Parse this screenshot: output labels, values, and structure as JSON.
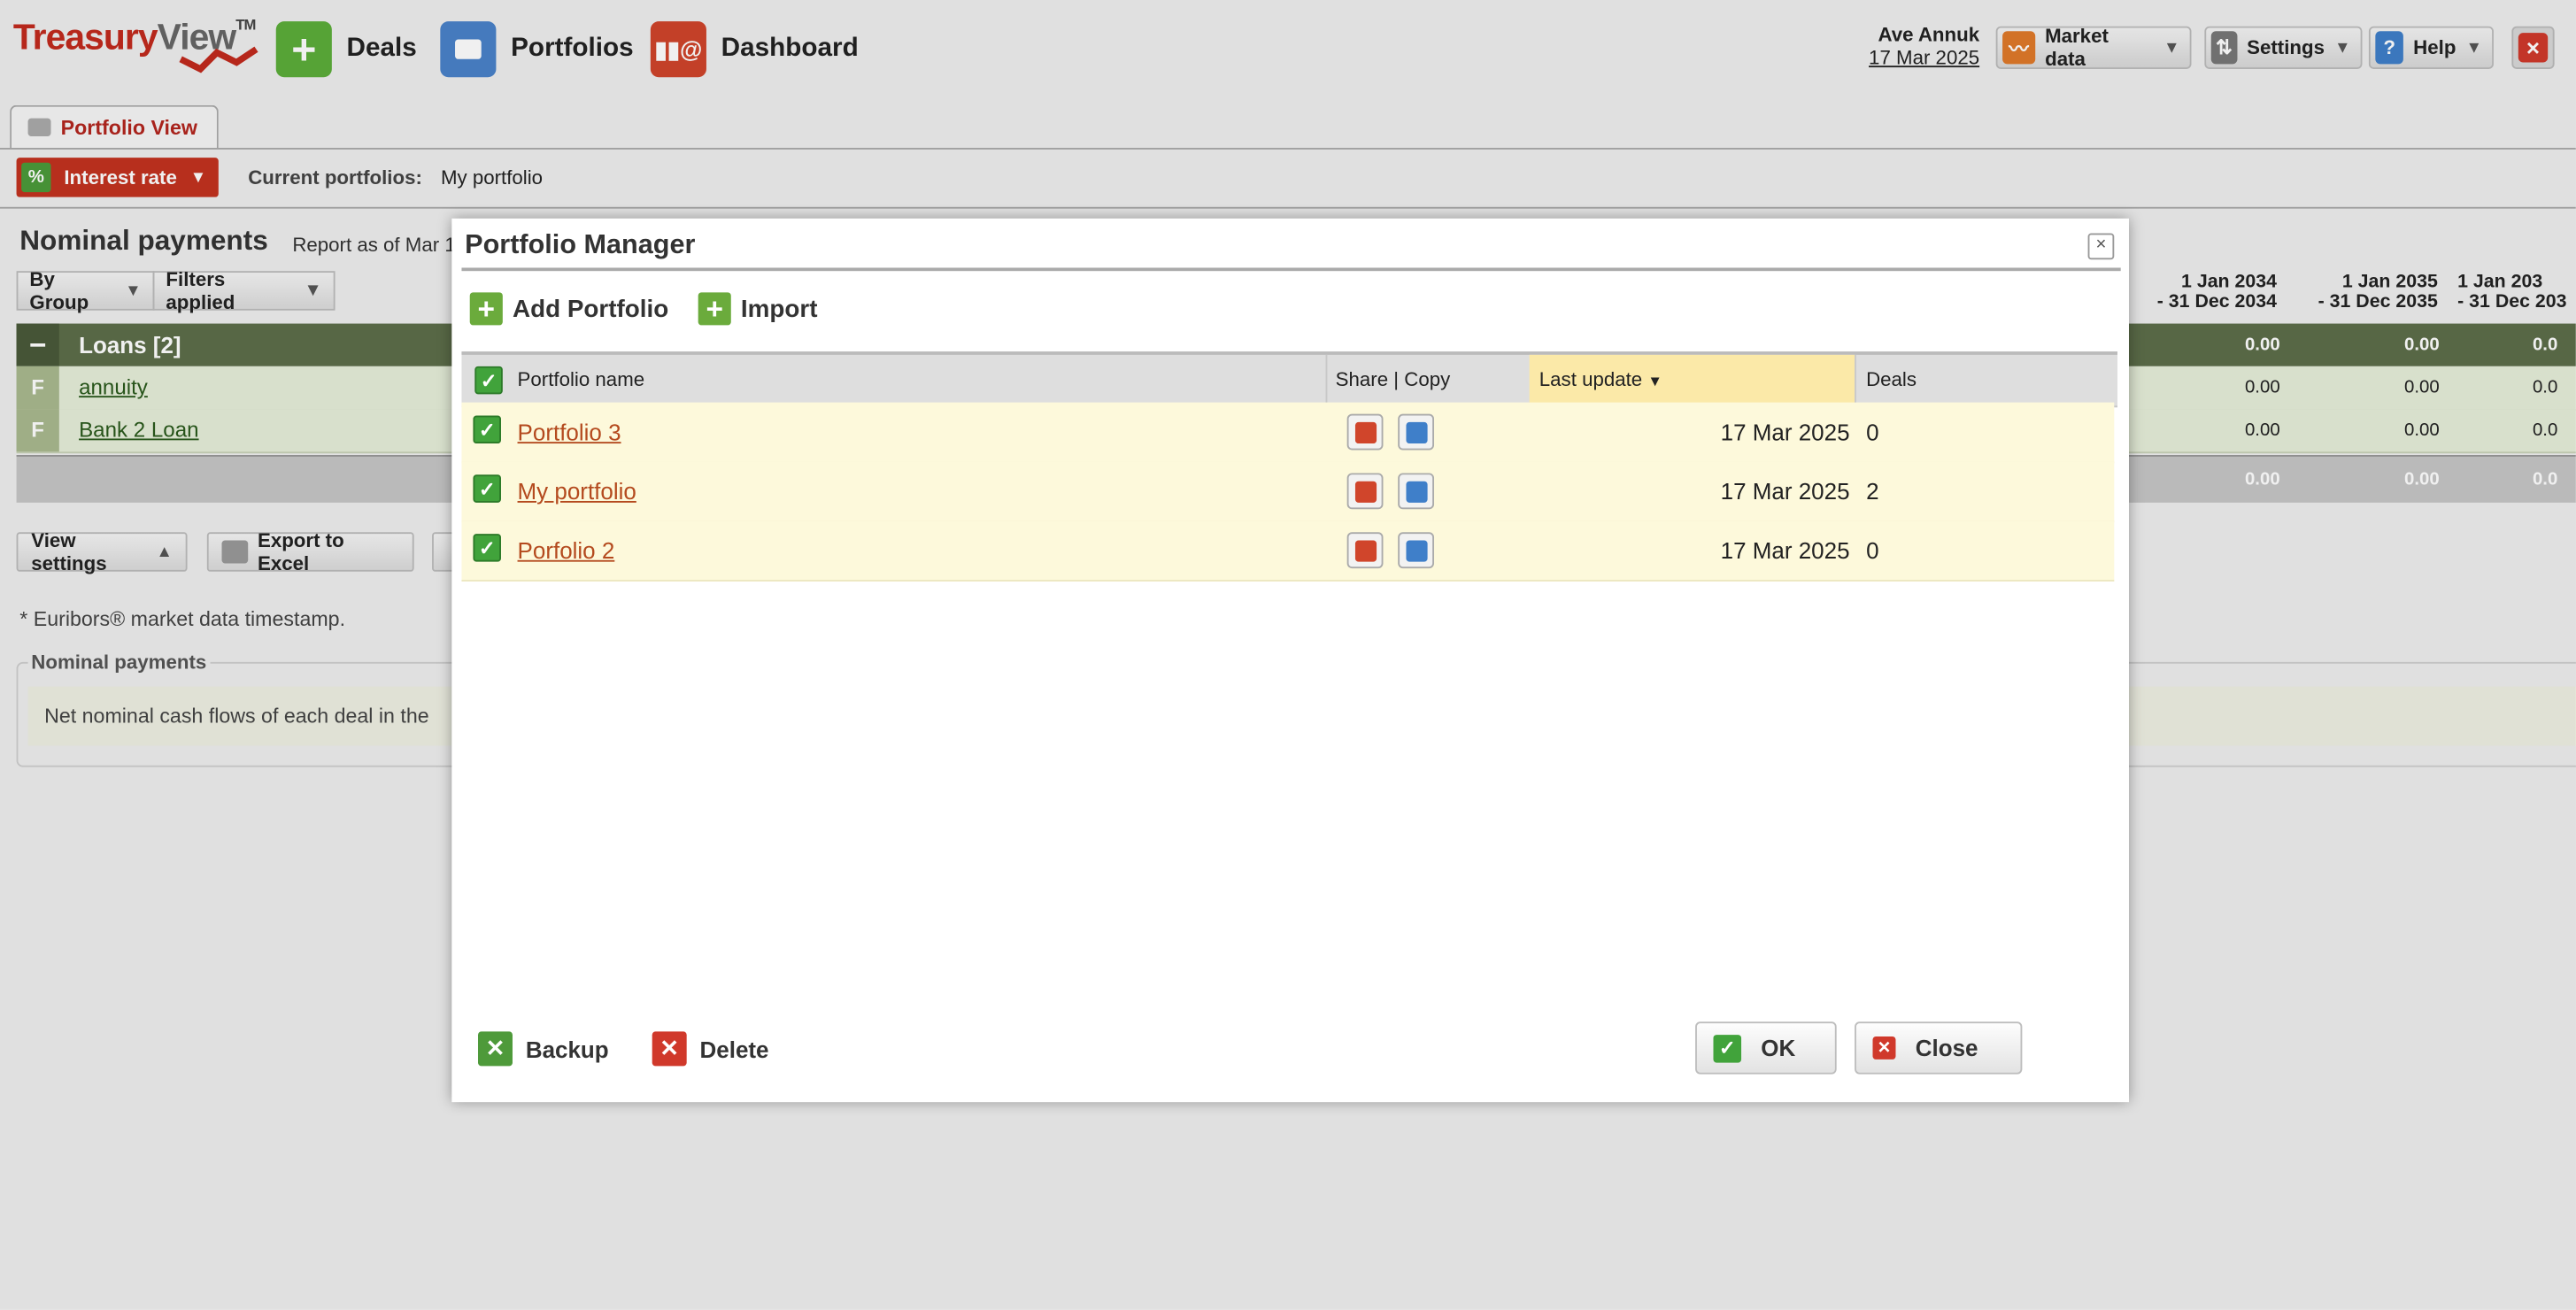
{
  "app": {
    "logo_part1": "Treasury",
    "logo_part2": "View",
    "logo_tm": "TM"
  },
  "nav": {
    "deals": "Deals",
    "portfolios": "Portfolios",
    "dashboard": "Dashboard"
  },
  "user": {
    "name": "Ave Annuk",
    "date": "17 Mar 2025"
  },
  "toolbar": {
    "market_data": "Market data",
    "settings": "Settings",
    "help": "Help"
  },
  "tab": {
    "label": "Portfolio View"
  },
  "subbar": {
    "rate_label": "Interest rate",
    "current_label": "Current portfolios:",
    "current_value": "My portfolio"
  },
  "report": {
    "title": "Nominal payments",
    "subtitle": "Report as of Mar 1",
    "group_label": "By Group",
    "filters_label": "Filters applied",
    "column_headers": [
      {
        "line1": "1 Jan 2034",
        "line2": "- 31 Dec 2034"
      },
      {
        "line1": "1 Jan 2035",
        "line2": "- 31 Dec 2035"
      },
      {
        "line1": "1 Jan 203",
        "line2": "- 31 Dec 203"
      }
    ],
    "group_row": {
      "label": "Loans [2]",
      "values": [
        "0.00",
        "0.00",
        "0.0"
      ]
    },
    "rows": [
      {
        "flag": "F",
        "name": "annuity",
        "values": [
          "0.00",
          "0.00",
          "0.0"
        ]
      },
      {
        "flag": "F",
        "name": "Bank 2 Loan",
        "values": [
          "0.00",
          "0.00",
          "0.0"
        ]
      }
    ],
    "total_values": [
      "0.00",
      "0.00",
      "0.0"
    ],
    "view_settings": "View settings",
    "export_excel": "Export to Excel",
    "note": "* Euribors® market data timestamp.",
    "legend": "Nominal payments",
    "description": "Net nominal cash flows of each deal in the"
  },
  "dialog": {
    "title": "Portfolio Manager",
    "add_portfolio": "Add Portfolio",
    "import": "Import",
    "headers": {
      "name": "Portfolio name",
      "share_copy": "Share | Copy",
      "last_update": "Last update",
      "deals": "Deals"
    },
    "rows": [
      {
        "name": "Portfolio 3",
        "last_update": "17 Mar 2025",
        "deals": "0"
      },
      {
        "name": "My portfolio",
        "last_update": "17 Mar 2025",
        "deals": "2"
      },
      {
        "name": "Porfolio 2",
        "last_update": "17 Mar 2025",
        "deals": "0"
      }
    ],
    "backup": "Backup",
    "delete": "Delete",
    "ok": "OK",
    "close": "Close"
  },
  "colors": {
    "brand_red": "#c22a1d",
    "accent_green": "#41a33b",
    "loans_header": "#5d6e4a",
    "sorted_column": "#fbe9a8",
    "row_highlight": "#fdf9db"
  }
}
